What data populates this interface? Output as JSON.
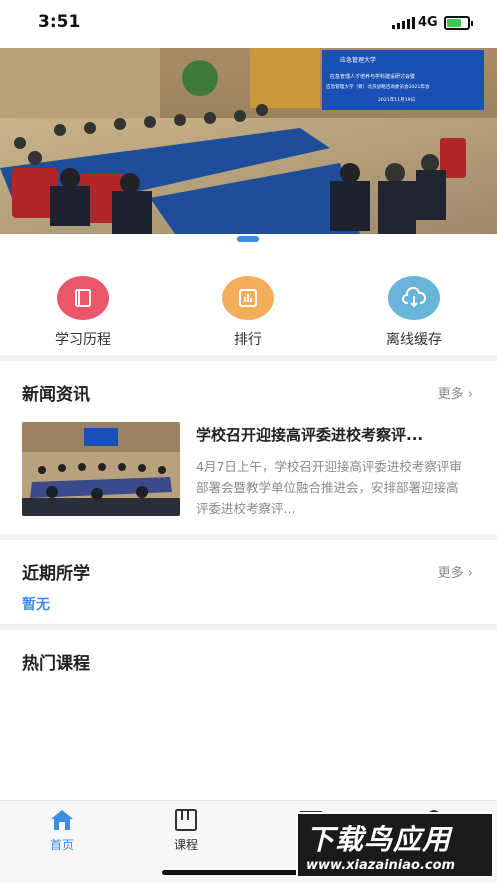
{
  "status_bar": {
    "time": "3:51",
    "network": "4G"
  },
  "banner": {
    "screen_line1": "应急管理人才培养与学科建设研讨会暨",
    "screen_line2": "应急管理大学（筹）北京战略咨询委员会2021年会",
    "screen_date": "2021年11月19日"
  },
  "quick_actions": [
    {
      "label": "学习历程",
      "icon": "book-icon",
      "color": "#e8586a"
    },
    {
      "label": "排行",
      "icon": "ranking-icon",
      "color": "#f3ae5c"
    },
    {
      "label": "离线缓存",
      "icon": "cloud-download-icon",
      "color": "#69b4d8"
    }
  ],
  "news": {
    "title": "新闻资讯",
    "more": "更多",
    "item": {
      "title": "学校召开迎接高评委进校考察评...",
      "summary": "4月7日上午，学校召开迎接高评委进校考察评审部署会暨教学单位融合推进会，安排部署迎接高评委进校考察评..."
    }
  },
  "recent": {
    "title": "近期所学",
    "more": "更多",
    "empty": "暂无"
  },
  "hot": {
    "title": "热门课程"
  },
  "tabbar": {
    "items": [
      {
        "label": "首页",
        "icon": "home-icon",
        "active": true
      },
      {
        "label": "课程",
        "icon": "course-icon",
        "active": false
      },
      {
        "label": "",
        "icon": "mail-icon",
        "active": false
      },
      {
        "label": "",
        "icon": "user-icon",
        "active": false
      }
    ]
  },
  "watermark": {
    "title": "下载鸟应用",
    "url": "www.xiazainiao.com"
  },
  "colors": {
    "accent": "#3b8de6",
    "muted": "#888888"
  }
}
